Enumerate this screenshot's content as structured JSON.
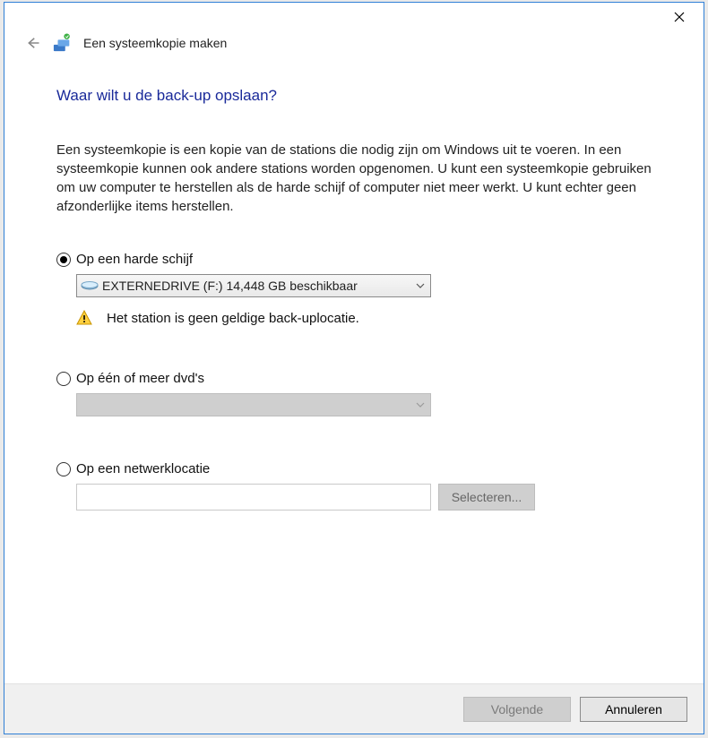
{
  "window": {
    "breadcrumb": "Een systeemkopie maken"
  },
  "page": {
    "heading": "Waar wilt u de back-up opslaan?",
    "description": "Een systeemkopie is een kopie van de stations die nodig zijn om Windows uit te voeren. In een systeemkopie kunnen ook andere stations worden opgenomen. U kunt een systeemkopie gebruiken om uw computer te herstellen als de harde schijf of computer niet meer werkt. U kunt echter geen afzonderlijke items herstellen."
  },
  "options": {
    "hdd": {
      "label": "Op een harde schijf",
      "selected": "EXTERNEDRIVE (F:)  14,448 GB beschikbaar",
      "warning": "Het station is geen geldige back-uplocatie."
    },
    "dvd": {
      "label": "Op één of meer dvd's",
      "selected": ""
    },
    "network": {
      "label": "Op een netwerklocatie",
      "path": "",
      "browse": "Selecteren..."
    }
  },
  "footer": {
    "next": "Volgende",
    "cancel": "Annuleren"
  }
}
